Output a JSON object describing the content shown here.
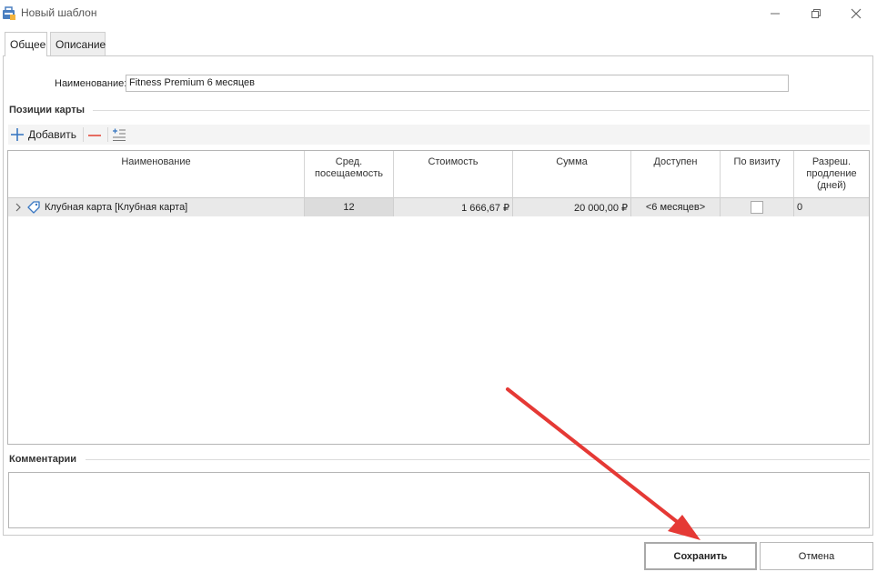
{
  "window": {
    "title": "Новый шаблон",
    "icon": "template-icon",
    "controls": [
      "minimize-icon",
      "restore-icon",
      "close-icon"
    ]
  },
  "tabs": [
    {
      "label": "Общее",
      "active": true
    },
    {
      "label": "Описание",
      "active": false
    }
  ],
  "form": {
    "name_label": "Наименование:",
    "name_value": "Fitness Premium 6 месяцев"
  },
  "positions": {
    "group_title": "Позиции карты",
    "toolbar": {
      "add_label": "Добавить",
      "add_icon": "plus-icon",
      "remove_icon": "minus-icon",
      "settings_icon": "list-settings-icon"
    },
    "columns": [
      "Наименование",
      "Сред. посещаемость",
      "Стоимость",
      "Сумма",
      "Доступен",
      "По визиту",
      "Разреш. продление (дней)"
    ],
    "rows": [
      {
        "name": "Клубная карта [Клубная карта]",
        "attendance": "12",
        "cost": "1 666,67 ₽",
        "sum": "20 000,00 ₽",
        "available": "<6 месяцев>",
        "per_visit": false,
        "extension_days": "0"
      }
    ]
  },
  "comments": {
    "group_title": "Комментарии",
    "value": ""
  },
  "buttons": {
    "save": "Сохранить",
    "cancel": "Отмена"
  },
  "colors": {
    "annotation_arrow": "#e53935",
    "accent_blue": "#3a78c2"
  }
}
